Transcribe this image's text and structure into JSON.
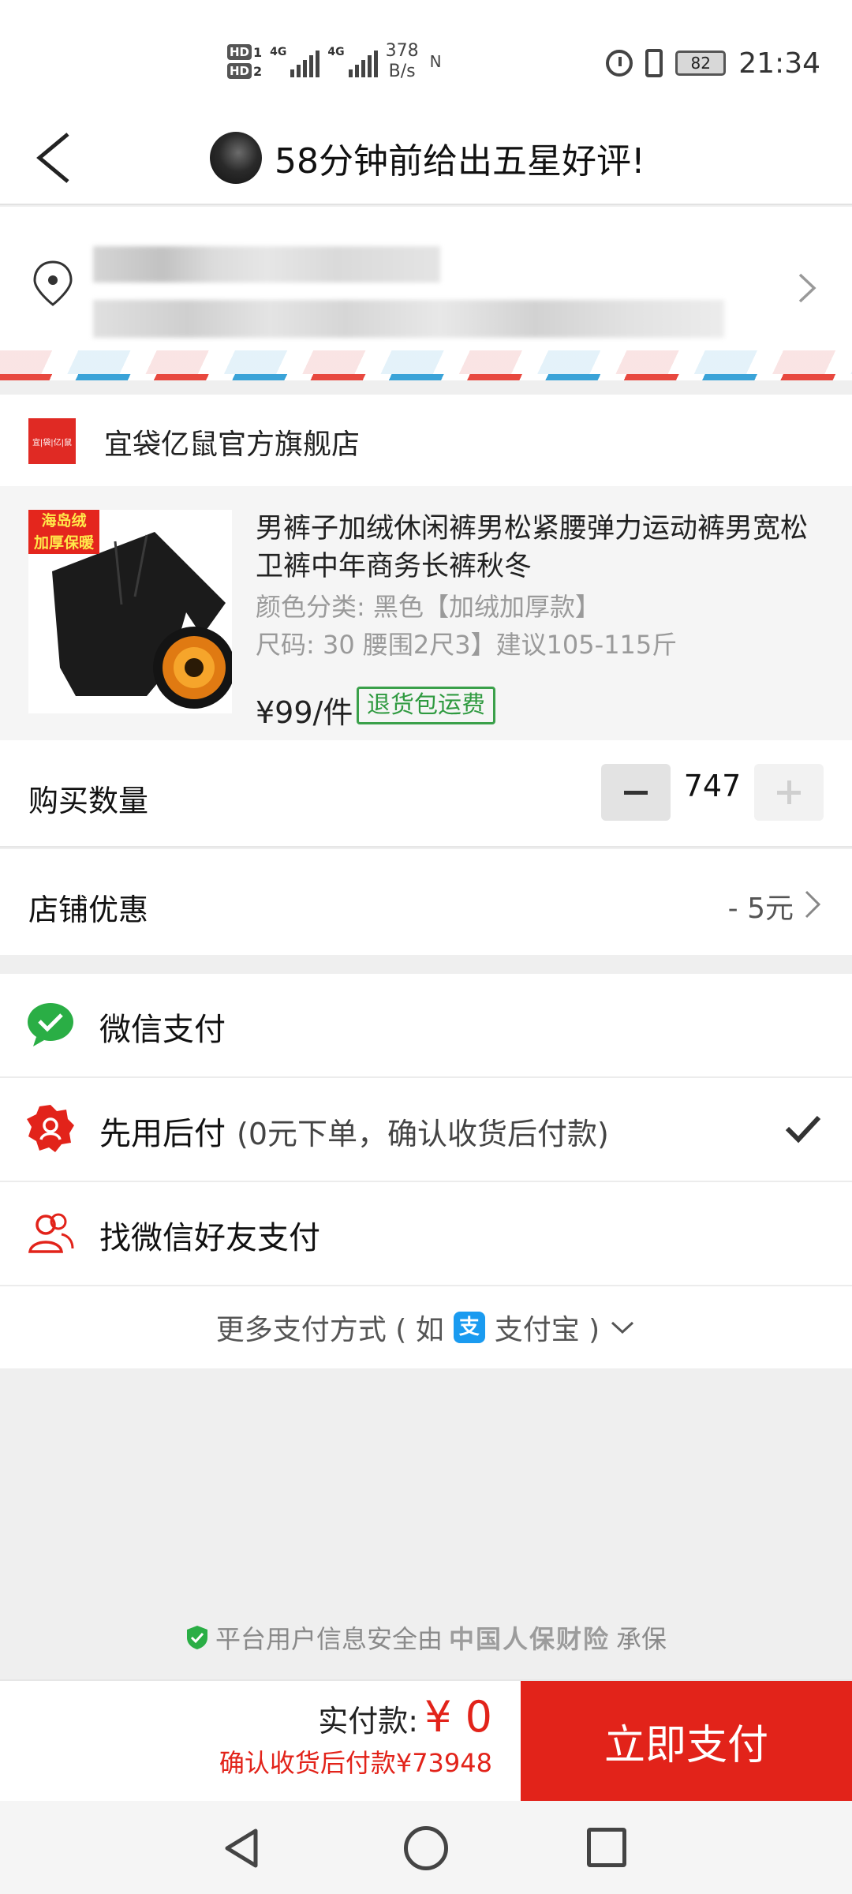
{
  "status_bar": {
    "hd1": "HD",
    "hd1_num": "1",
    "hd2": "HD",
    "hd2_num": "2",
    "net1": "4G",
    "net2": "4G",
    "speed_value": "378",
    "speed_unit": "B/s",
    "nfc_icon": "N",
    "battery": "82",
    "time": "21:34"
  },
  "header": {
    "title": "58分钟前给出五星好评!"
  },
  "store": {
    "logo_text": "宜|袋|亿|鼠",
    "name": "宜袋亿鼠官方旗舰店"
  },
  "product": {
    "badge_line1": "海岛绒",
    "badge_line2": "加厚保暖",
    "title": "男裤子加绒休闲裤男松紧腰弹力运动裤男宽松卫裤中年商务长裤秋冬",
    "spec_color": "颜色分类: 黑色【加绒加厚款】",
    "spec_size": "尺码: 30 腰围2尺3】建议105-115斤",
    "price": "¥99/件",
    "return_tag": "退货包运费"
  },
  "quantity": {
    "label": "购买数量",
    "value": "747"
  },
  "coupon": {
    "label": "店铺优惠",
    "value": "- 5元"
  },
  "payment": {
    "wechat": "微信支付",
    "paylater": "先用后付",
    "paylater_note": "(0元下单，确认收货后付款)",
    "friend": "找微信好友支付",
    "more_prefix": "更多支付方式 ( 如",
    "alipay_icon": "支",
    "alipay_label": "支付宝 )"
  },
  "insurance": {
    "text": "平台用户信息安全由",
    "brand": "中国人保财险",
    "suffix": "承保"
  },
  "bottom": {
    "total_label": "实付款:",
    "total_value": "¥ 0",
    "later_text": "确认收货后付款¥73948",
    "pay_button": "立即支付"
  },
  "colors": {
    "accent_red": "#e2231a",
    "wechat_green": "#2aae45",
    "tag_green": "#3aa04a",
    "alipay_blue": "#1a9bf0"
  },
  "icons": {
    "back": "chevron-left-icon",
    "location": "location-pin-icon",
    "address_chevron": "chevron-right-icon",
    "wechat": "wechat-pay-icon",
    "paylater": "pay-later-badge-icon",
    "friend": "friends-icon",
    "selected": "checkmark-icon",
    "more": "chevron-down-icon",
    "shield": "shield-check-icon"
  }
}
